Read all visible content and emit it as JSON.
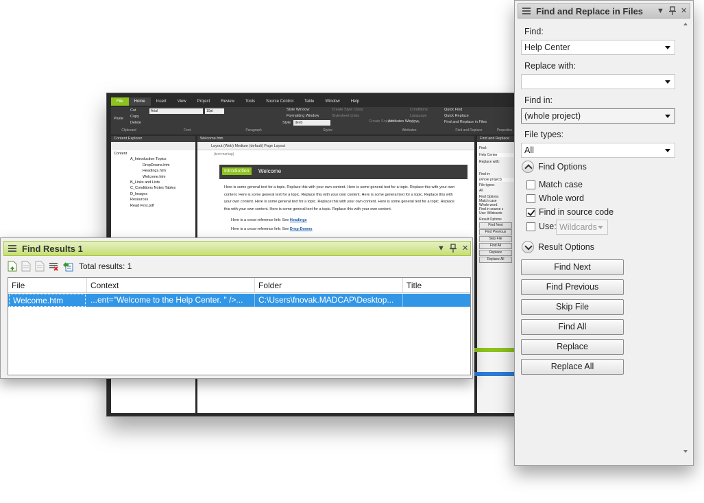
{
  "background_app": {
    "tabs": [
      "File",
      "Home",
      "Insert",
      "View",
      "Project",
      "Review",
      "Tools",
      "Source Control",
      "Table",
      "Window",
      "Help"
    ],
    "ribbon": {
      "paste": "Paste",
      "cut": "Cut",
      "copy": "Copy",
      "delete": "Delete",
      "clipboard": "Clipboard",
      "font_name": "Arial",
      "font_size": "10pt",
      "font_group": "Font",
      "paragraph_group": "Paragraph",
      "style_window": "Style Window",
      "formatting_window": "Formatting Window",
      "style_label": "Style",
      "style_value": "(text)",
      "create_style_class": "Create Style Class",
      "stylesheet_links": "Stylesheet Links",
      "styles_group": "Styles",
      "create_snippet": "Create Snippet",
      "attributes_window": "Attributes Window",
      "conditions": "Conditions",
      "language": "Language",
      "name": "Name",
      "attributes_group": "Attributes",
      "quick_find": "Quick Find",
      "quick_replace": "Quick Replace",
      "find_replace_files": "Find and Replace in Files",
      "find_replace_group": "Find and Replace",
      "properties_group": "Properties"
    },
    "content_explorer": {
      "title": "Content Explorer",
      "items": [
        "Content",
        "A_Introduction Topics",
        "DropDowns.htm",
        "Headings.htm",
        "Welcome.htm",
        "B_Links and Lists",
        "C_Conditions Notes Tables",
        "D_Images",
        "Resources",
        "Read First.pdf"
      ]
    },
    "editor": {
      "tab": "Welcome.htm",
      "toolbar": "Layout (Web)   Medium (default)   Page Layout",
      "markup": "(text markup)",
      "intro_tag": "Introduction",
      "intro_title": "Welcome",
      "body": "Here is some general text for a topic. Replace this with your own content. Here is some general text for a topic. Replace this with your own content. Here is some general text for a topic. Replace this with your own content. Here is some general text for a topic. Replace this with your own content. Here is some general text for a topic. Replace this with your own content. Here is some general text for a topic. Replace this with your own content. Here is some general text for a topic. Replace this with your own content.",
      "xref1_text": "Here is a cross-reference link: See ",
      "xref1_link": "Headings",
      "xref2_text": "Here is a cross-reference link: See ",
      "xref2_link": "Drop-Downs"
    },
    "right_pane": {
      "title": "Find and Replace",
      "find": "Find:",
      "find_value": "Help Center",
      "replace_with": "Replace with:",
      "find_in": "Find in:",
      "find_in_value": "(whole project)",
      "file_types": "File types:",
      "file_types_value": "All",
      "find_options": "Find Options",
      "match_case": "Match case",
      "whole_word": "Whole word",
      "find_in_source": "Find in source c",
      "use": "Use:",
      "wildcards": "Wildcards",
      "result_options": "Result Options",
      "buttons": [
        "Find Next",
        "Find Previous",
        "Skip File",
        "Find All",
        "Replace",
        "Replace All"
      ]
    }
  },
  "find_results": {
    "title": "Find Results 1",
    "total_results": "Total results: 1",
    "columns": [
      "File",
      "Context",
      "Folder",
      "Title"
    ],
    "rows": [
      {
        "file": "Welcome.htm",
        "context": "...ent=\"Welcome to the Help Center. \" />...",
        "folder": "C:\\Users\\fnovak.MADCAP\\Desktop...",
        "title": ""
      }
    ]
  },
  "find_replace": {
    "title": "Find and Replace in Files",
    "find_label": "Find:",
    "find_value": "Help Center",
    "replace_label": "Replace with:",
    "replace_value": "",
    "find_in_label": "Find in:",
    "find_in_value": "(whole project)",
    "file_types_label": "File types:",
    "file_types_value": "All",
    "find_options_label": "Find Options",
    "options": {
      "match_case": {
        "label": "Match case",
        "checked": false
      },
      "whole_word": {
        "label": "Whole word",
        "checked": false
      },
      "find_in_source": {
        "label": "Find in source code",
        "checked": true
      },
      "use": {
        "label": "Use:",
        "checked": false
      }
    },
    "use_value": "Wildcards",
    "result_options_label": "Result Options",
    "buttons": {
      "find_next": "Find Next",
      "find_previous": "Find Previous",
      "skip_file": "Skip File",
      "find_all": "Find All",
      "replace": "Replace",
      "replace_all": "Replace All"
    }
  },
  "colors": {
    "accent_green": "#8dc21f",
    "selection_blue": "#3296e6",
    "dark_ui": "#2b2b2b"
  }
}
